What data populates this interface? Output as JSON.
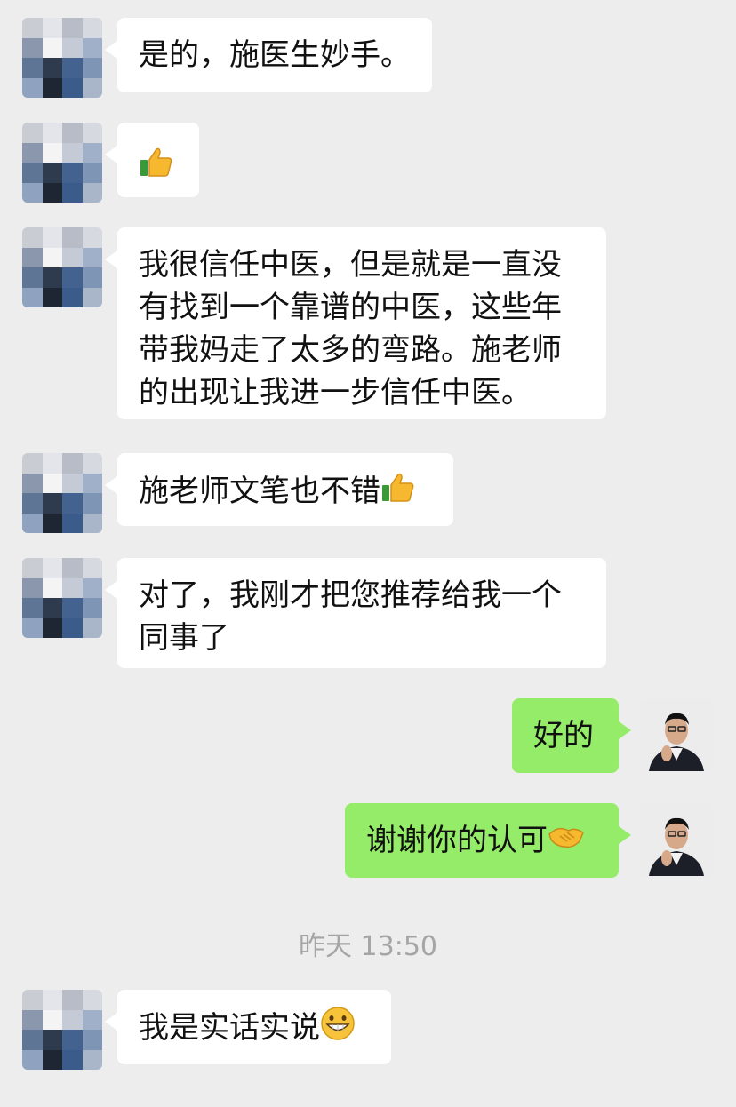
{
  "messages": [
    {
      "from": "other",
      "text": "是的，施医生妙手。"
    },
    {
      "from": "other",
      "text": "",
      "emoji": "thumbs-up-icon"
    },
    {
      "from": "other",
      "lines": [
        "我很信任中医，但是就是一直没",
        "有找到一个靠谱的中医，这些年",
        "带我妈走了太多的弯路。施老师",
        "的出现让我进一步信任中医。"
      ]
    },
    {
      "from": "other",
      "text": "施老师文笔也不错",
      "emoji": "thumbs-up-icon"
    },
    {
      "from": "other",
      "lines": [
        "对了，我刚才把您推荐给我一个",
        "同事了"
      ]
    },
    {
      "from": "me",
      "text": "好的"
    },
    {
      "from": "me",
      "text": "谢谢你的认可",
      "emoji": "handshake-icon"
    },
    {
      "from": "other",
      "text": "我是实话实说",
      "emoji": "grinning-face-icon"
    }
  ],
  "timestamp": "昨天 13:50",
  "colors": {
    "background": "#ededed",
    "incoming_bubble": "#ffffff",
    "outgoing_bubble": "#95ec69",
    "timestamp_text": "#a5a5a5"
  }
}
